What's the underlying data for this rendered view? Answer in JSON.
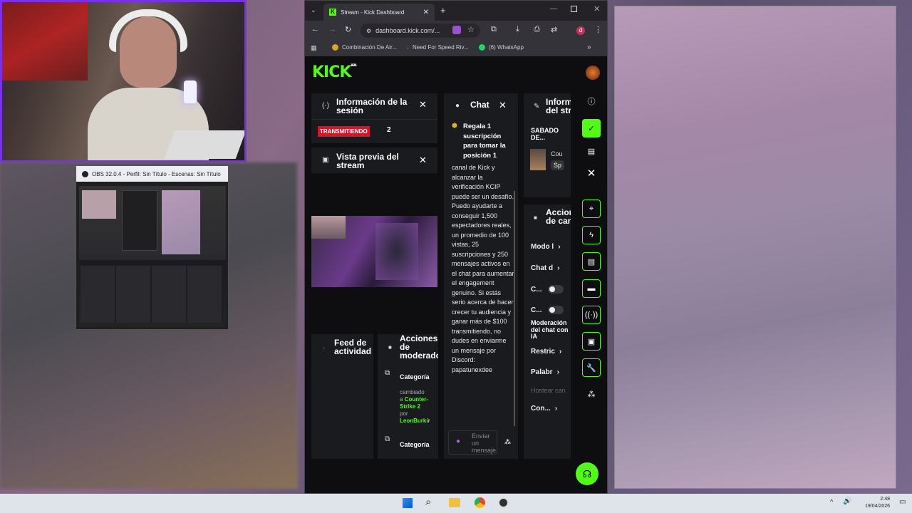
{
  "obs": {
    "title": "OBS 32.0.4 - Perfil: Sin Título - Escenas: Sin Título"
  },
  "browser": {
    "tab_title": "Stream - Kick Dashboard",
    "url": "dashboard.kick.com/...",
    "profile_letter": "d",
    "bookmarks": [
      "Combinación De Air...",
      "Need For Speed Riv...",
      "(6) WhatsApp"
    ]
  },
  "kick": {
    "logo": "KICK",
    "logo_sup": "BETA",
    "session": {
      "title": "Información de la sesión",
      "status": "TRANSMITIENDO",
      "count": "2"
    },
    "preview": {
      "title": "Vista previa del stream"
    },
    "feed": {
      "title": "Feed de actividad"
    },
    "mod_actions": {
      "title": "Acciones de moderador",
      "items": [
        {
          "label": "Categoría",
          "changed": "cambiado",
          "a": "a",
          "category": "Counter-Strike 2",
          "por": "por",
          "user": "LeonBurkir"
        },
        {
          "label": "Categoría"
        }
      ]
    },
    "chat": {
      "title": "Chat",
      "pinned": "Regala 1 suscripción para tomar la posición 1",
      "message": "canal de Kick y alcanzar la verificación KCIP puede ser un desafío. Puedo ayudarte a conseguir 1,500 espectadores reales, un promedio de 100 vistas, 25 suscripciones y 250 mensajes activos en el chat para aumentar el engagement genuino. Si estás serio acerca de hacer crecer tu audiencia y ganar más de $100 transmitiendo, no dudes en enviarme un mensaje por Discord: papatunexdee",
      "placeholder": "Enviar un mensaje"
    },
    "stream_info": {
      "title": "Información del stream",
      "title_short": "Inform del str",
      "stream_title": "SABADO DE...",
      "game_short": "Cou",
      "tag_short": "Sp"
    },
    "channel_actions": {
      "title": "Acciones de canal",
      "title_short": "Accion de can",
      "modo": "Modo l",
      "chat_d": "Chat d",
      "c1": "C...",
      "c2": "C...",
      "ai_mod": "Moderación del chat con IA",
      "restric": "Restric",
      "palabr": "Palabr",
      "hostear": "Hostear can",
      "con": "Con..."
    }
  },
  "taskbar": {
    "time": "2:48",
    "date": "19/04/2026"
  },
  "colors": {
    "kick_green": "#53fc18",
    "live_red": "#d7142a",
    "obs_border": "#7a2ef0"
  }
}
